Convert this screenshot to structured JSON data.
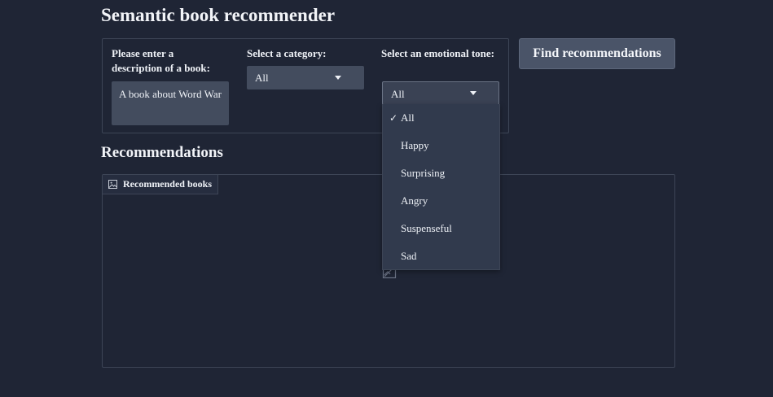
{
  "app": {
    "title": "Semantic book recommender"
  },
  "inputs": {
    "description_label": "Please enter a description of a book:",
    "description_value": "A book about Word War",
    "category_label": "Select a category:",
    "category_value": "All",
    "tone_label": "Select an emotional tone:",
    "tone_value": "All",
    "find_button_label": "Find recommendations"
  },
  "tone_menu": {
    "options": [
      "All",
      "Happy",
      "Surprising",
      "Angry",
      "Suspenseful",
      "Sad"
    ],
    "selected": "All",
    "check_glyph": "✓"
  },
  "results": {
    "heading": "Recommendations",
    "gallery_label": "Recommended books",
    "gallery_icon": "image-icon",
    "placeholder_icon": "empty-image-icon"
  },
  "colors": {
    "background": "#1f2535",
    "panel_border": "#3d4556",
    "input_bg": "#434c5e",
    "button_bg": "#4a5468",
    "menu_bg": "#313a4d",
    "text": "#eef1f6"
  }
}
